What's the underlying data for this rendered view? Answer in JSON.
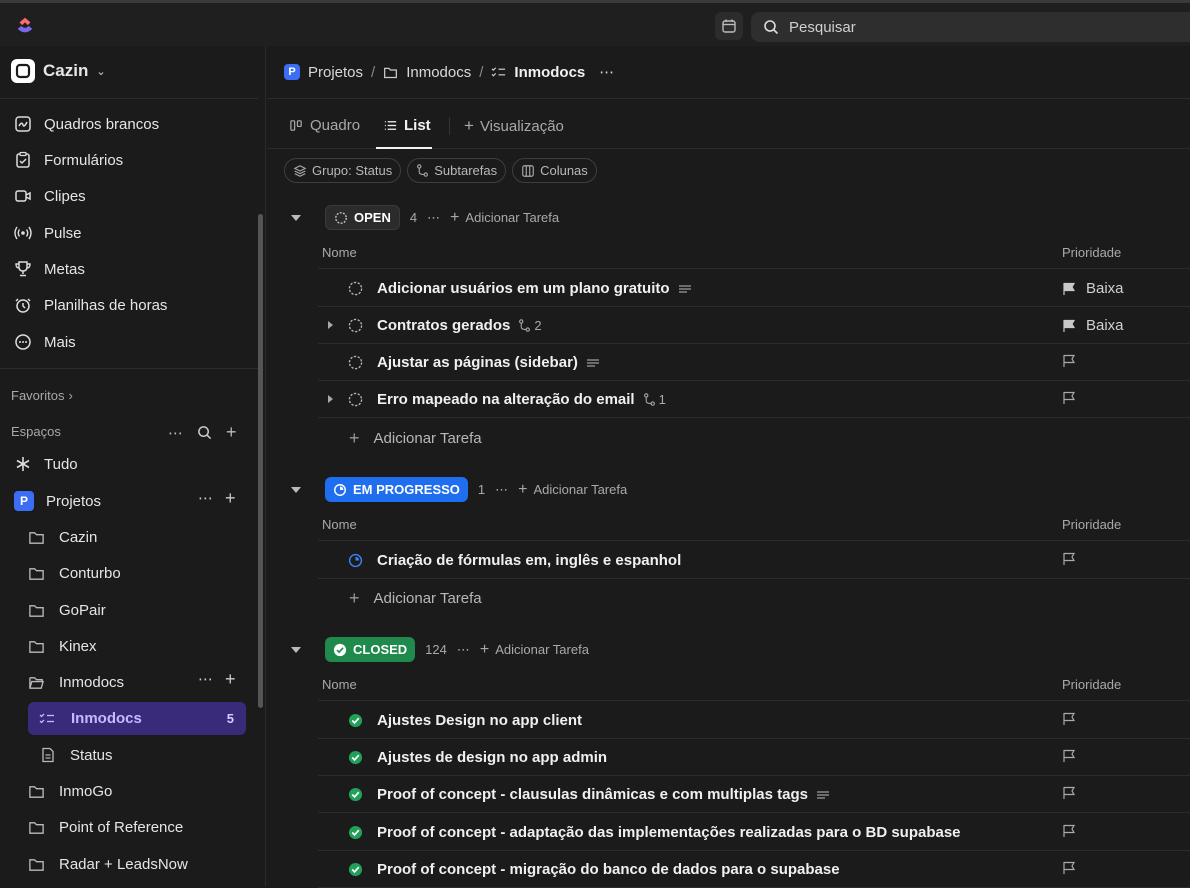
{
  "topbar": {
    "search_placeholder": "Pesquisar"
  },
  "workspace": {
    "name": "Cazin"
  },
  "nav": [
    {
      "label": "Quadros brancos",
      "icon": "whiteboard-icon"
    },
    {
      "label": "Formulários",
      "icon": "form-icon"
    },
    {
      "label": "Clipes",
      "icon": "clip-video-icon"
    },
    {
      "label": "Pulse",
      "icon": "pulse-icon"
    },
    {
      "label": "Metas",
      "icon": "trophy-icon"
    },
    {
      "label": "Planilhas de horas",
      "icon": "timesheet-icon"
    },
    {
      "label": "Mais",
      "icon": "more-icon"
    }
  ],
  "favorites_label": "Favoritos",
  "spaces_label": "Espaços",
  "spaces": {
    "all_label": "Tudo",
    "space_name": "Projetos",
    "space_badge": "P",
    "folders": [
      "Cazin",
      "Conturbo",
      "GoPair",
      "Kinex",
      "Inmodocs"
    ],
    "active_list": {
      "label": "Inmodocs",
      "count": "5"
    },
    "doc": "Status",
    "folders_after": [
      "InmoGo",
      "Point of Reference",
      "Radar + LeadsNow"
    ]
  },
  "breadcrumb": {
    "space": "Projetos",
    "folder": "Inmodocs",
    "list": "Inmodocs",
    "badge": "P"
  },
  "tabs": {
    "board": "Quadro",
    "list": "List",
    "add_view": "Visualização"
  },
  "chips": {
    "group": "Grupo: Status",
    "subtasks": "Subtarefas",
    "columns": "Colunas"
  },
  "columns": {
    "name": "Nome",
    "priority": "Prioridade"
  },
  "add_task_label": "Adicionar Tarefa",
  "groups": [
    {
      "status": "OPEN",
      "count": "4",
      "color": "#2b2b2b",
      "tasks": [
        {
          "name": "Adicionar usuários em um plano gratuito",
          "meta": "desc",
          "priority": "Baixa"
        },
        {
          "name": "Contratos gerados",
          "meta": "sub",
          "subcount": "2",
          "priority": "Baixa",
          "expand": true
        },
        {
          "name": "Ajustar as páginas (sidebar)",
          "meta": "desc",
          "priority": ""
        },
        {
          "name": "Erro mapeado na alteração do email",
          "meta": "sub",
          "subcount": "1",
          "priority": "",
          "expand": true
        }
      ]
    },
    {
      "status": "EM PROGRESSO",
      "count": "1",
      "color": "#1f6ef0",
      "tasks": [
        {
          "name": "Criação de fórmulas em, inglês e espanhol",
          "priority": ""
        }
      ]
    },
    {
      "status": "CLOSED",
      "count": "124",
      "color": "#1f8a4c",
      "tasks": [
        {
          "name": "Ajustes Design no app client",
          "priority": ""
        },
        {
          "name": "Ajustes de design no app admin",
          "priority": ""
        },
        {
          "name": "Proof of concept - clausulas dinâmicas e com multiplas tags",
          "meta": "desc",
          "priority": ""
        },
        {
          "name": "Proof of concept - adaptação das implementações realizadas para o BD supabase",
          "priority": ""
        },
        {
          "name": "Proof of concept - migração do banco de dados para o supabase",
          "priority": ""
        }
      ]
    }
  ]
}
